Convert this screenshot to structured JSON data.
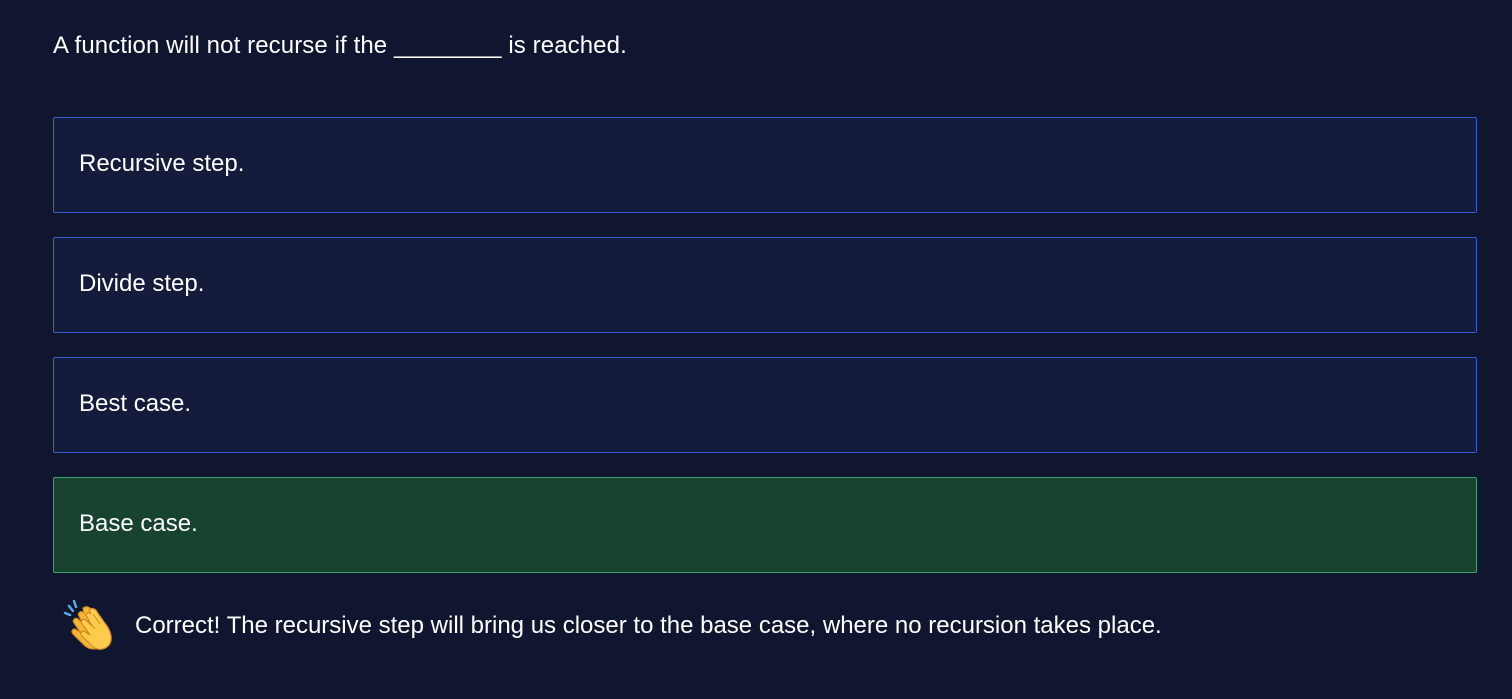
{
  "question": {
    "text": "A function will not recurse if the ________ is reached."
  },
  "options": [
    {
      "label": "Recursive step."
    },
    {
      "label": "Divide step."
    },
    {
      "label": "Best case."
    },
    {
      "label": "Base case.",
      "state": "correct"
    }
  ],
  "feedback": {
    "icon": "clapping-hands-icon",
    "text": "Correct! The recursive step will bring us closer to the base case, where no recursion takes place."
  },
  "colors": {
    "background": "#10162f",
    "option_bg": "#151c3b",
    "option_border": "#3a5ccc",
    "correct_bg": "#17432f",
    "correct_border": "#3f9e6f"
  }
}
